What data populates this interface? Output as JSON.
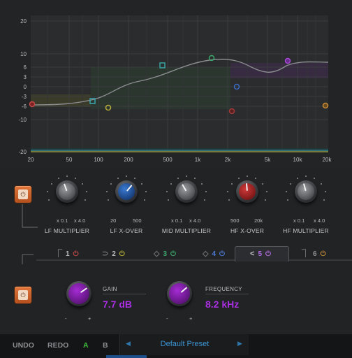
{
  "graph": {
    "db_ticks": [
      "20",
      "10",
      "6",
      "3",
      "0",
      "-3",
      "-6",
      "-10",
      "-20"
    ],
    "freq_ticks": [
      "20",
      "50",
      "100",
      "200",
      "500",
      "1k",
      "2k",
      "5k",
      "10k",
      "20k"
    ]
  },
  "shelf_knobs": [
    {
      "title": "LF MULTIPLIER",
      "min_label": "x 0.1",
      "max_label": "x 4.0"
    },
    {
      "title": "LF X-OVER",
      "min_label": "20",
      "max_label": "500"
    },
    {
      "title": "MID MULTIPLIER",
      "min_label": "x 0.1",
      "max_label": "x 4.0"
    },
    {
      "title": "HF X-OVER",
      "min_label": "500",
      "max_label": "20k"
    },
    {
      "title": "HF MULTIPLIER",
      "min_label": "x 0.1",
      "max_label": "x 4.0"
    }
  ],
  "bands": [
    {
      "number": "1",
      "shape": "⎾",
      "color": "#c44a4a"
    },
    {
      "number": "2",
      "shape": "⊃",
      "color": "#b8b03a"
    },
    {
      "number": "3",
      "shape": "◇",
      "color": "#3aa86a"
    },
    {
      "number": "4",
      "shape": "◇",
      "color": "#3a6ac4"
    },
    {
      "number": "5",
      "shape": "<",
      "color": "#a64ad8"
    },
    {
      "number": "6",
      "shape": "⏋",
      "color": "#c48a3a"
    }
  ],
  "band_controls": {
    "gain_label": "GAIN",
    "gain_value": "7.7 dB",
    "frequency_label": "FREQUENCY",
    "frequency_value": "8.2 kHz",
    "minus": "-",
    "plus": "+"
  },
  "footer": {
    "undo": "UNDO",
    "redo": "REDO",
    "a": "A",
    "b": "B",
    "preset_name": "Default Preset"
  },
  "colors": {
    "accent_purple": "#a82fe0",
    "power_orange": "#d8672c",
    "preset_blue": "#3c97d6",
    "ab_active_green": "#3fbf3f"
  }
}
